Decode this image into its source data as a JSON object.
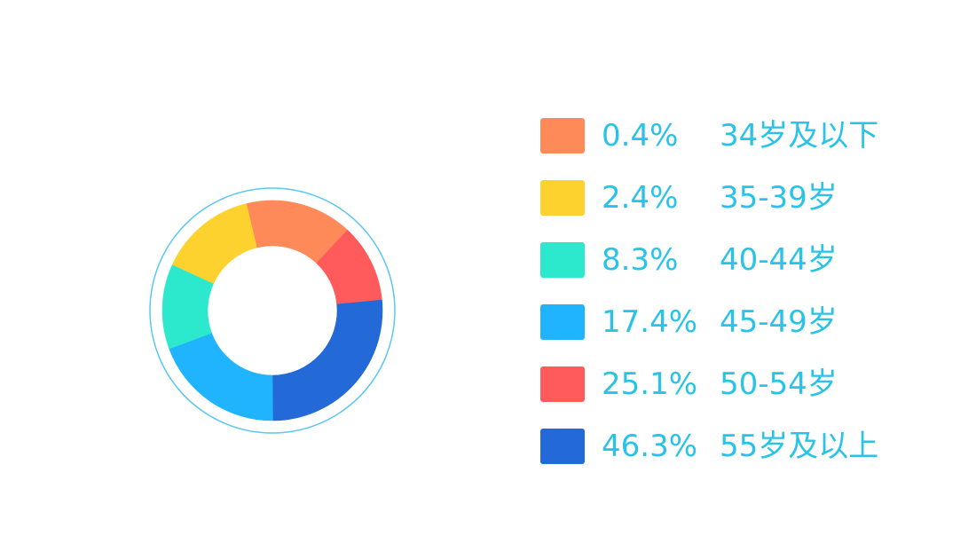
{
  "chart_data": {
    "type": "pie",
    "categories": [
      "34岁及以下",
      "35-39岁",
      "40-44岁",
      "45-49岁",
      "50-54岁",
      "55岁及以上"
    ],
    "values": [
      0.4,
      2.4,
      8.3,
      17.4,
      25.1,
      46.3
    ],
    "value_labels": [
      "0.4%",
      "2.4%",
      "8.3%",
      "17.4%",
      "25.1%",
      "46.3%"
    ],
    "colors": [
      "#fe8a5a",
      "#fdd22f",
      "#2ce9cd",
      "#1fb4fd",
      "#ff5b5c",
      "#2369d8"
    ],
    "donut": true,
    "legend_position": "right"
  },
  "style": {
    "text_color": "#29c3ea",
    "ring_color": "#5bc7f3",
    "background": "#ffffff"
  }
}
